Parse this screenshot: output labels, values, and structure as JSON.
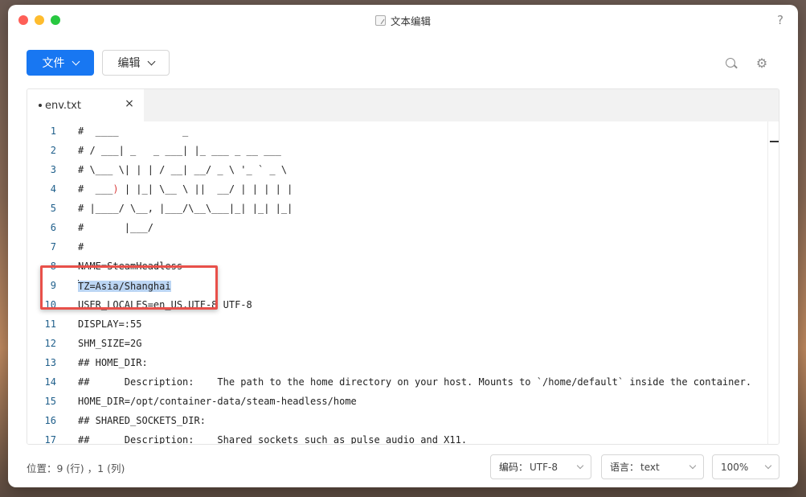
{
  "window": {
    "title": "文本编辑",
    "help": "?"
  },
  "toolbar": {
    "file_label": "文件",
    "edit_label": "编辑"
  },
  "tab": {
    "name": "env.txt",
    "close": "×"
  },
  "code_lines": [
    {
      "n": "1",
      "text": "#  ____           _"
    },
    {
      "n": "2",
      "text": "# / ___| _   _ ___| |_ ___ _ __ ___"
    },
    {
      "n": "3",
      "text": "# \\___ \\| | | / __| __/ _ \\ '_ ` _ \\"
    },
    {
      "n": "4a",
      "text": "#  ___"
    },
    {
      "n": "4b",
      "text": ")"
    },
    {
      "n": "4c",
      "text": " | |_| \\__ \\ ||  __/ | | | | |"
    },
    {
      "n": "5",
      "text": "# |____/ \\__, |___/\\__\\___|_| |_| |_|"
    },
    {
      "n": "6",
      "text": "#       |___/"
    },
    {
      "n": "7",
      "text": "#"
    },
    {
      "n": "8",
      "text": "NAME=SteamHeadless"
    },
    {
      "n": "9",
      "text": "TZ=Asia/Shanghai"
    },
    {
      "n": "10",
      "text": "USER_LOCALES=en_US.UTF-8 UTF-8"
    },
    {
      "n": "11",
      "text": "DISPLAY=:55"
    },
    {
      "n": "12",
      "text": "SHM_SIZE=2G"
    },
    {
      "n": "13",
      "text": "## HOME_DIR:"
    },
    {
      "n": "14",
      "text": "##      Description:    The path to the home directory on your host. Mounts to `/home/default` inside the container."
    },
    {
      "n": "15",
      "text": "HOME_DIR=/opt/container-data/steam-headless/home"
    },
    {
      "n": "16",
      "text": "## SHARED_SOCKETS_DIR:"
    },
    {
      "n": "17",
      "text": "##      Description:    Shared sockets such as pulse audio and X11."
    }
  ],
  "line_numbers": [
    "1",
    "2",
    "3",
    "4",
    "5",
    "6",
    "7",
    "8",
    "9",
    "10",
    "11",
    "12",
    "13",
    "14",
    "15",
    "16",
    "17"
  ],
  "status": {
    "position": "位置：9 (行) ，1 (列)",
    "encoding_label": "编码：",
    "encoding_value": "UTF-8",
    "language_label": "语言：",
    "language_value": "text",
    "zoom": "100%"
  },
  "colors": {
    "accent": "#1877f2",
    "selection": "#bcd6f4",
    "highlight_border": "#e8504a"
  },
  "icons": {
    "search": "search-icon",
    "settings": "gear-icon"
  }
}
